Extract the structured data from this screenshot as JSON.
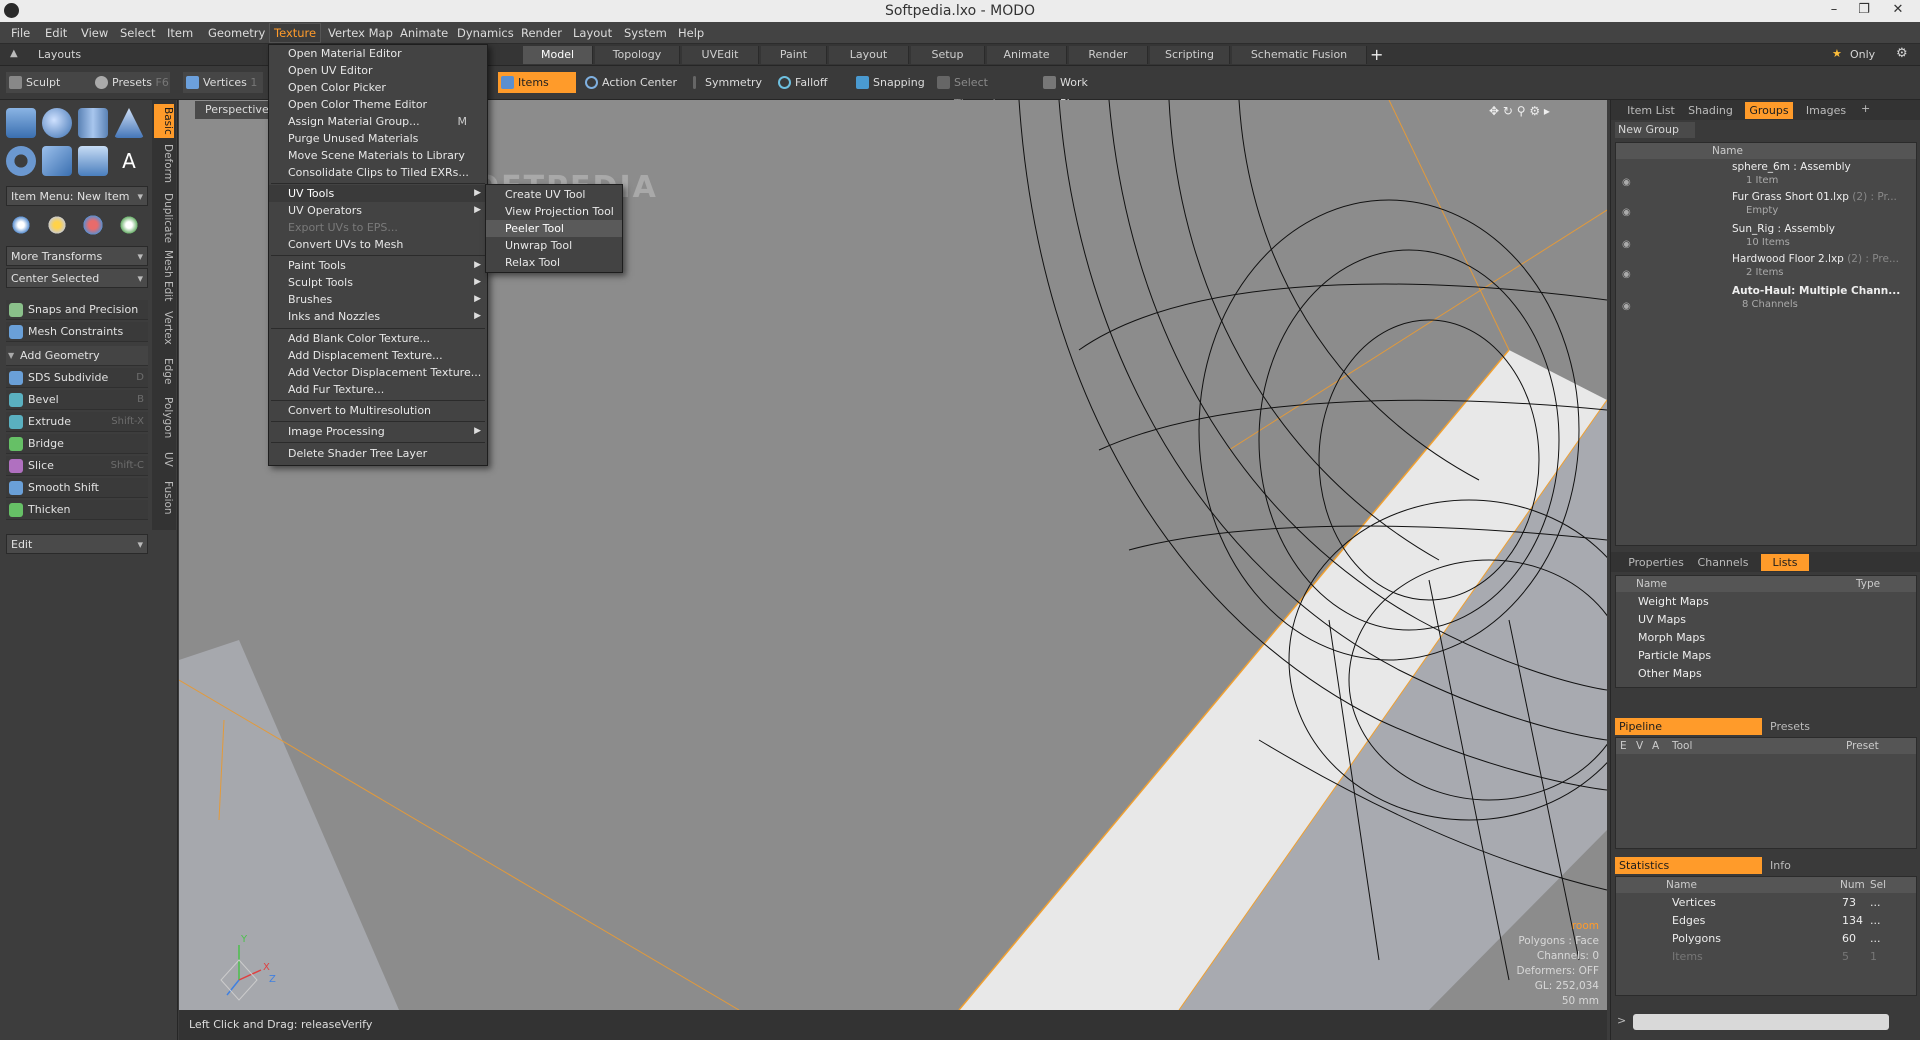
{
  "window": {
    "title": "Softpedia.lxo - MODO"
  },
  "menubar": [
    "File",
    "Edit",
    "View",
    "Select",
    "Item",
    "Geometry",
    "Texture",
    "Vertex Map",
    "Animate",
    "Dynamics",
    "Render",
    "Layout",
    "System",
    "Help"
  ],
  "layouts": {
    "label": "Layouts",
    "tabs": [
      "Model",
      "Topology",
      "UVEdit",
      "Paint",
      "Layout",
      "Setup",
      "Animate",
      "Render",
      "Scripting",
      "Schematic Fusion"
    ],
    "only_label": "Only"
  },
  "toolbar": {
    "sculpt": "Sculpt",
    "presets": "Presets",
    "presets_key": "F6",
    "vertices": "Vertices",
    "vertices_key": "1",
    "items": "Items",
    "action_center": "Action Center",
    "symmetry": "Symmetry",
    "falloff": "Falloff",
    "snapping": "Snapping",
    "select_through": "Select Through",
    "work_plane": "Work Plane"
  },
  "left_panel": {
    "item_menu": "Item Menu: New Item",
    "more_transforms": "More Transforms",
    "center_selected": "Center Selected",
    "snaps": "Snaps and Precision",
    "mesh_constraints": "Mesh Constraints",
    "add_geometry": "Add Geometry",
    "tools": [
      {
        "label": "SDS Subdivide",
        "key": "D"
      },
      {
        "label": "Bevel",
        "key": "B"
      },
      {
        "label": "Extrude",
        "key": "Shift-X"
      },
      {
        "label": "Bridge",
        "key": ""
      },
      {
        "label": "Slice",
        "key": "Shift-C"
      },
      {
        "label": "Smooth Shift",
        "key": ""
      },
      {
        "label": "Thicken",
        "key": ""
      }
    ],
    "edit": "Edit",
    "vtabs": [
      "Basic",
      "Deform",
      "Duplicate",
      "Mesh Edit",
      "Vertex",
      "Edge",
      "Polygon",
      "UV",
      "Fusion"
    ]
  },
  "texture_menu": {
    "items": [
      "Open Material Editor",
      "Open UV Editor",
      "Open Color Picker",
      "Open Color Theme Editor",
      "Assign Material Group...",
      "Purge Unused Materials",
      "Move Scene Materials to Library",
      "Consolidate Clips to Tiled EXRs...",
      "UV Tools",
      "UV Operators",
      "Export UVs to EPS...",
      "Convert UVs to Mesh",
      "Paint Tools",
      "Sculpt Tools",
      "Brushes",
      "Inks and Nozzles",
      "Add Blank Color Texture...",
      "Add Displacement Texture...",
      "Add Vector Displacement Texture...",
      "Add Fur Texture...",
      "Convert to Multiresolution",
      "Image Processing",
      "Delete Shader Tree Layer"
    ],
    "assign_shortcut": "M"
  },
  "uv_submenu": [
    "Create UV Tool",
    "View Projection Tool",
    "Peeler Tool",
    "Unwrap Tool",
    "Relax Tool"
  ],
  "watermark": "SOFTPEDIA",
  "viewport": {
    "label": "Perspective",
    "info": [
      "room",
      "Polygons : Face",
      "Channels: 0",
      "Deformers: OFF",
      "GL: 252,034",
      "50 mm"
    ],
    "axes": [
      "Y",
      "X",
      "Z"
    ]
  },
  "status": {
    "hint": "Left Click and Drag:",
    "value": "releaseVerify"
  },
  "groups_panel": {
    "tabs": [
      "Item List",
      "Shading",
      "Groups",
      "Images"
    ],
    "new_group": "New Group",
    "name_header": "Name",
    "rows": [
      {
        "name": "sphere_6m : Assembly",
        "sub": "1 Item"
      },
      {
        "name": "Fur Grass Short 01.lxp",
        "extra": "(2) : Pr...",
        "sub": "Empty"
      },
      {
        "name": "Sun_Rig : Assembly",
        "sub": "10 Items"
      },
      {
        "name": "Hardwood Floor 2.lxp",
        "extra": "(2) : Pre...",
        "sub": "2 Items"
      },
      {
        "name": "Auto-Haul: Multiple Chann...",
        "sub": "8 Channels"
      }
    ]
  },
  "lists_panel": {
    "tabs": [
      "Properties",
      "Channels",
      "Lists"
    ],
    "name_header": "Name",
    "type_header": "Type",
    "rows": [
      "Weight Maps",
      "UV Maps",
      "Morph Maps",
      "Particle Maps",
      "Other Maps"
    ]
  },
  "pipeline_panel": {
    "tabs": [
      "Pipeline",
      "Presets"
    ],
    "headers": [
      "E",
      "V",
      "A",
      "Tool",
      "Preset"
    ]
  },
  "stats_panel": {
    "tabs": [
      "Statistics",
      "Info"
    ],
    "headers": [
      "Name",
      "Num",
      "Sel"
    ],
    "rows": [
      {
        "name": "Vertices",
        "num": "73",
        "sel": "..."
      },
      {
        "name": "Edges",
        "num": "134",
        "sel": "..."
      },
      {
        "name": "Polygons",
        "num": "60",
        "sel": "..."
      },
      {
        "name": "Items",
        "num": "5",
        "sel": "1"
      }
    ]
  },
  "colors": {
    "accent": "#ff9b2a",
    "viewport_bg": "#8c8c8c",
    "panel_bg": "#3a3a3a"
  }
}
